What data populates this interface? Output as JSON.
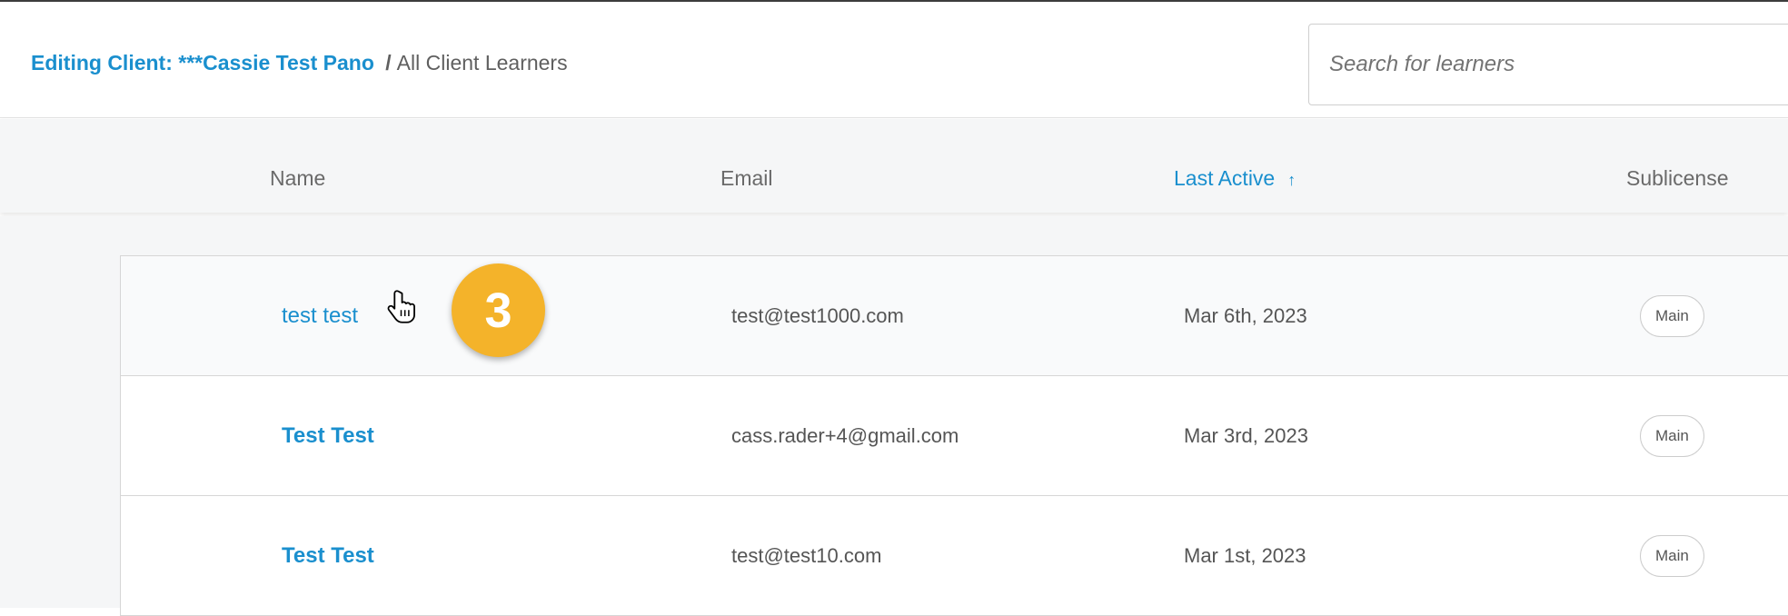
{
  "header": {
    "breadcrumb": {
      "prefix": "Editing Client: ",
      "client_name": "***Cassie Test Pano",
      "separator": "/",
      "current": "All Client Learners"
    },
    "search": {
      "placeholder": "Search for learners"
    }
  },
  "table": {
    "columns": [
      {
        "label": "Name"
      },
      {
        "label": "Email"
      },
      {
        "label": "Last Active",
        "sorted": "ascending",
        "sort_icon": "↑"
      },
      {
        "label": "Sublicense"
      }
    ],
    "rows": [
      {
        "name": "test test",
        "email": "test@test1000.com",
        "last_active": "Mar 6th, 2023",
        "sublicense": "Main"
      },
      {
        "name": "Test Test",
        "email": "cass.rader+4@gmail.com",
        "last_active": "Mar 3rd, 2023",
        "sublicense": "Main"
      },
      {
        "name": "Test Test",
        "email": "test@test10.com",
        "last_active": "Mar 1st, 2023",
        "sublicense": "Main"
      }
    ]
  },
  "annotation": {
    "step_number": "3",
    "color": "#f4b32a"
  },
  "colors": {
    "accent": "#1a8fce",
    "header_bg": "#f5f6f7",
    "text": "#555555"
  },
  "icons": {
    "cursor": "hand-pointer-icon",
    "sort": "arrow-up-icon"
  }
}
